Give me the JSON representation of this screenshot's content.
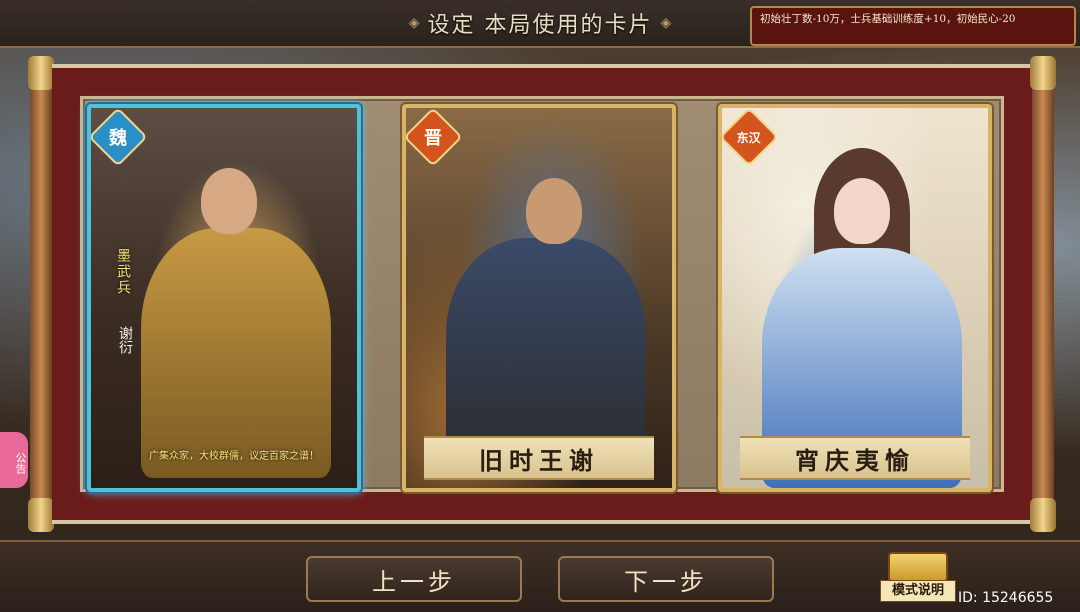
{
  "header": {
    "title": "设定 本局使用的卡片",
    "info": "初始壮丁数-10万，士兵基础训练度+10，初始民心-20"
  },
  "cards": [
    {
      "faction": "魏",
      "side_label": "墨武兵",
      "side_sign": "谢衍",
      "quote": "广集众家，大校群儒，议定百家之谱！",
      "name": ""
    },
    {
      "faction": "晋",
      "name": "旧时王谢"
    },
    {
      "faction": "东汉",
      "name": "宵庆夷愉"
    }
  ],
  "buttons": {
    "prev": "上一步",
    "next": "下一步",
    "mode": "模式说明"
  },
  "side_tab": "公告",
  "user_id": "ID: 15246655",
  "colors": {
    "scroll_red": "#6a1c1a",
    "card_gold": "#d8b46a",
    "selected_glow": "#4fc2d8"
  }
}
